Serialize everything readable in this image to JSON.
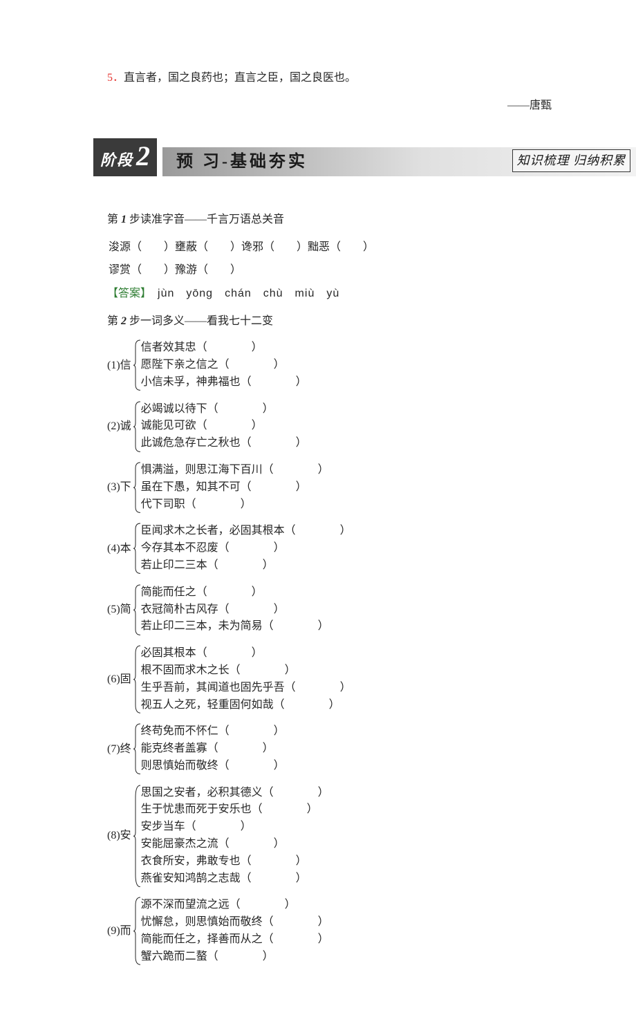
{
  "quote": {
    "number": "5．",
    "text": "直言者，国之良药也；直言之臣，国之良医也。",
    "attribution": "——唐甄"
  },
  "banner": {
    "stage_label": "阶段",
    "stage_number": "2",
    "title": "预 习-基础夯实",
    "subtitle": "知识梳理 归纳积累"
  },
  "step1": {
    "title_prefix": "第 ",
    "step_num": "1",
    "title_suffix": " 步读准字音——千言万语总关音",
    "lines": [
      "浚源（　　）壅蔽（　　）谗邪（　　）黜恶（　　）",
      "谬赏（　　）豫游（　　）"
    ],
    "answer_tag": "【答案】",
    "answer": "　jùn　yōng　chán　chù　miù　yù"
  },
  "step2": {
    "title_prefix": "第 ",
    "step_num": "2",
    "title_suffix": " 步一词多义——看我七十二变",
    "groups": [
      {
        "label": "(1)信",
        "items": [
          "信者效其忠（　　　　）",
          "愿陛下亲之信之（　　　　）",
          "小信未孚，神弗福也（　　　　）"
        ]
      },
      {
        "label": "(2)诚",
        "items": [
          "必竭诚以待下（　　　　）",
          "诚能见可欲（　　　　）",
          "此诚危急存亡之秋也（　　　　）"
        ]
      },
      {
        "label": "(3)下",
        "items": [
          "惧满溢，则思江海下百川（　　　　）",
          "虽在下愚，知其不可（　　　　）",
          "代下司职（　　　　）"
        ]
      },
      {
        "label": "(4)本",
        "items": [
          "臣闻求木之长者，必固其根本（　　　　）",
          "今存其本不忍废（　　　　）",
          "若止印二三本（　　　　）"
        ]
      },
      {
        "label": "(5)简",
        "items": [
          "简能而任之（　　　　）",
          "衣冠简朴古风存（　　　　）",
          "若止印二三本，未为简易（　　　　）"
        ]
      },
      {
        "label": "(6)固",
        "items": [
          "必固其根本（　　　　）",
          "根不固而求木之长（　　　　）",
          "生乎吾前，其闻道也固先乎吾（　　　　）",
          "视五人之死，轻重固何如哉（　　　　）"
        ]
      },
      {
        "label": "(7)终",
        "items": [
          "终苟免而不怀仁（　　　　）",
          "能克终者盖寡（　　　　）",
          "则思慎始而敬终（　　　　）"
        ]
      },
      {
        "label": "(8)安",
        "items": [
          "思国之安者，必积其德义（　　　　）",
          "生于忧患而死于安乐也（　　　　）",
          "安步当车（　　　　）",
          "安能屈豪杰之流（　　　　）",
          "衣食所安，弗敢专也（　　　　）",
          "燕雀安知鸿鹄之志哉（　　　　）"
        ]
      },
      {
        "label": "(9)而",
        "items": [
          "源不深而望流之远（　　　　）",
          "忧懈怠，则思慎始而敬终（　　　　）",
          "简能而任之，择善而从之（　　　　）",
          "蟹六跪而二螯（　　　　）"
        ]
      }
    ]
  }
}
